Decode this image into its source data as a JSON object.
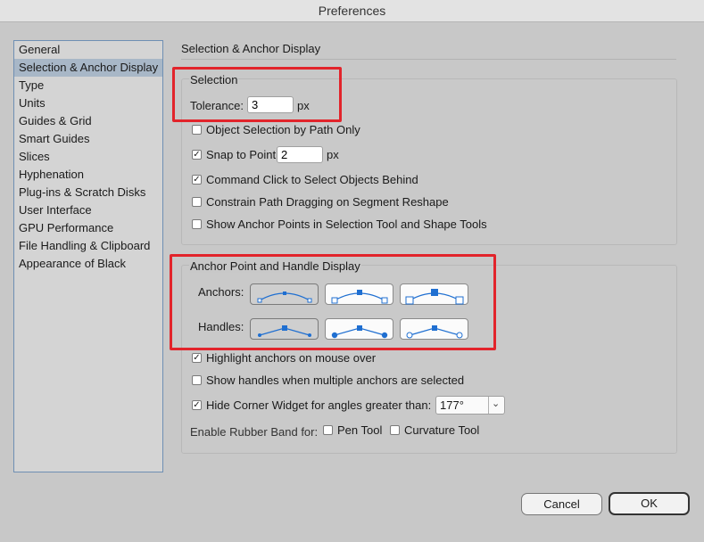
{
  "window": {
    "title": "Preferences"
  },
  "sidebar": {
    "items": [
      {
        "label": "General"
      },
      {
        "label": "Selection & Anchor Display"
      },
      {
        "label": "Type"
      },
      {
        "label": "Units"
      },
      {
        "label": "Guides & Grid"
      },
      {
        "label": "Smart Guides"
      },
      {
        "label": "Slices"
      },
      {
        "label": "Hyphenation"
      },
      {
        "label": "Plug-ins & Scratch Disks"
      },
      {
        "label": "User Interface"
      },
      {
        "label": "GPU Performance"
      },
      {
        "label": "File Handling & Clipboard"
      },
      {
        "label": "Appearance of Black"
      }
    ],
    "selected_index": 1
  },
  "panel": {
    "title": "Selection & Anchor Display"
  },
  "selection": {
    "title": "Selection",
    "tolerance_label": "Tolerance:",
    "tolerance_value": "3",
    "tolerance_unit": "px",
    "object_by_path": {
      "label": "Object Selection by Path Only",
      "checked": false
    },
    "snap_to_point": {
      "label": "Snap to Point",
      "checked": true,
      "value": "2",
      "unit": "px"
    },
    "command_click": {
      "label": "Command Click to Select Objects Behind",
      "checked": true
    },
    "constrain_path": {
      "label": "Constrain Path Dragging on Segment Reshape",
      "checked": false
    },
    "show_anchor_points": {
      "label": "Show Anchor Points in Selection Tool and Shape Tools",
      "checked": false
    }
  },
  "anchor_display": {
    "title": "Anchor Point and Handle Display",
    "anchors_label": "Anchors:",
    "handles_label": "Handles:",
    "anchors_selected": 0,
    "handles_selected": 0,
    "anchor_icons": [
      "anchor-style-small-icon",
      "anchor-style-medium-icon",
      "anchor-style-large-icon"
    ],
    "handle_icons": [
      "handle-style-square-icon",
      "handle-style-solid-dot-icon",
      "handle-style-hollow-dot-icon"
    ],
    "highlight_anchors": {
      "label": "Highlight anchors on mouse over",
      "checked": true
    },
    "show_handles_multiple": {
      "label": "Show handles when multiple anchors are selected",
      "checked": false
    },
    "hide_corner_widget": {
      "label": "Hide Corner Widget for angles greater than:",
      "checked": true,
      "value": "177°"
    },
    "rubber_band_label": "Enable Rubber Band for:",
    "pen_tool": {
      "label": "Pen Tool",
      "checked": false
    },
    "curvature_tool": {
      "label": "Curvature Tool",
      "checked": false
    }
  },
  "buttons": {
    "cancel": "Cancel",
    "ok": "OK"
  },
  "colors": {
    "highlight_box": "#e2242b",
    "icon_blue": "#1f6fd1",
    "sidebar_selected": "#a8b7c7"
  }
}
